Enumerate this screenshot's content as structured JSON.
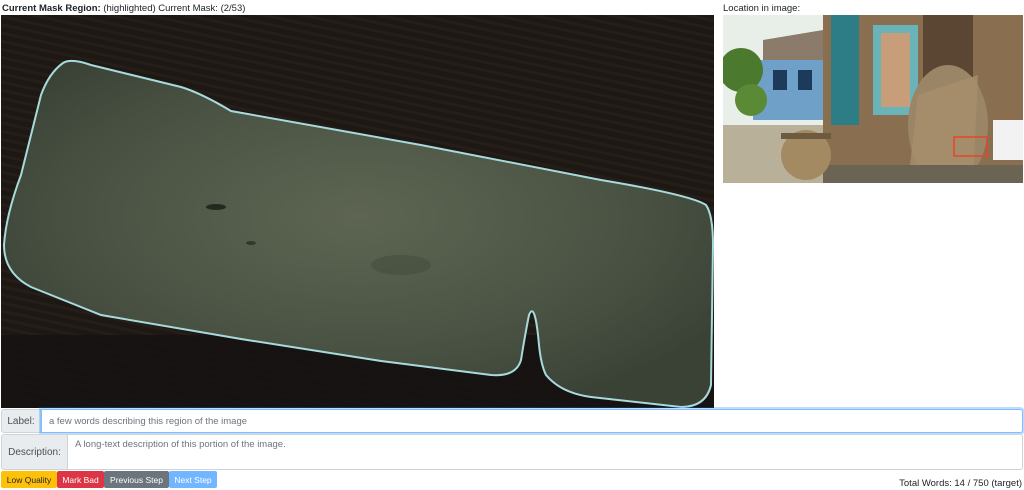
{
  "header": {
    "title_bold": "Current Mask Region:",
    "title_rest": "(highlighted) Current Mask: (2/53)"
  },
  "location": {
    "label": "Location in image:"
  },
  "form": {
    "label_caption": "Label:",
    "label_placeholder": "a few words describing this region of the image",
    "label_value": "",
    "description_caption": "Description:",
    "description_placeholder": "A long-text description of this portion of the image.",
    "description_value": ""
  },
  "buttons": {
    "low_quality": "Low Quality",
    "mark_bad": "Mark Bad",
    "previous_step": "Previous Step",
    "next_step": "Next Step"
  },
  "footer": {
    "word_count": "Total Words: 14 / 750 (target)"
  },
  "colors": {
    "warning": "#ffc107",
    "danger": "#dc3545",
    "secondary": "#6c757d",
    "primary": "#007bff",
    "mask_outline": "#a8dadc",
    "location_box": "#e8442a"
  }
}
